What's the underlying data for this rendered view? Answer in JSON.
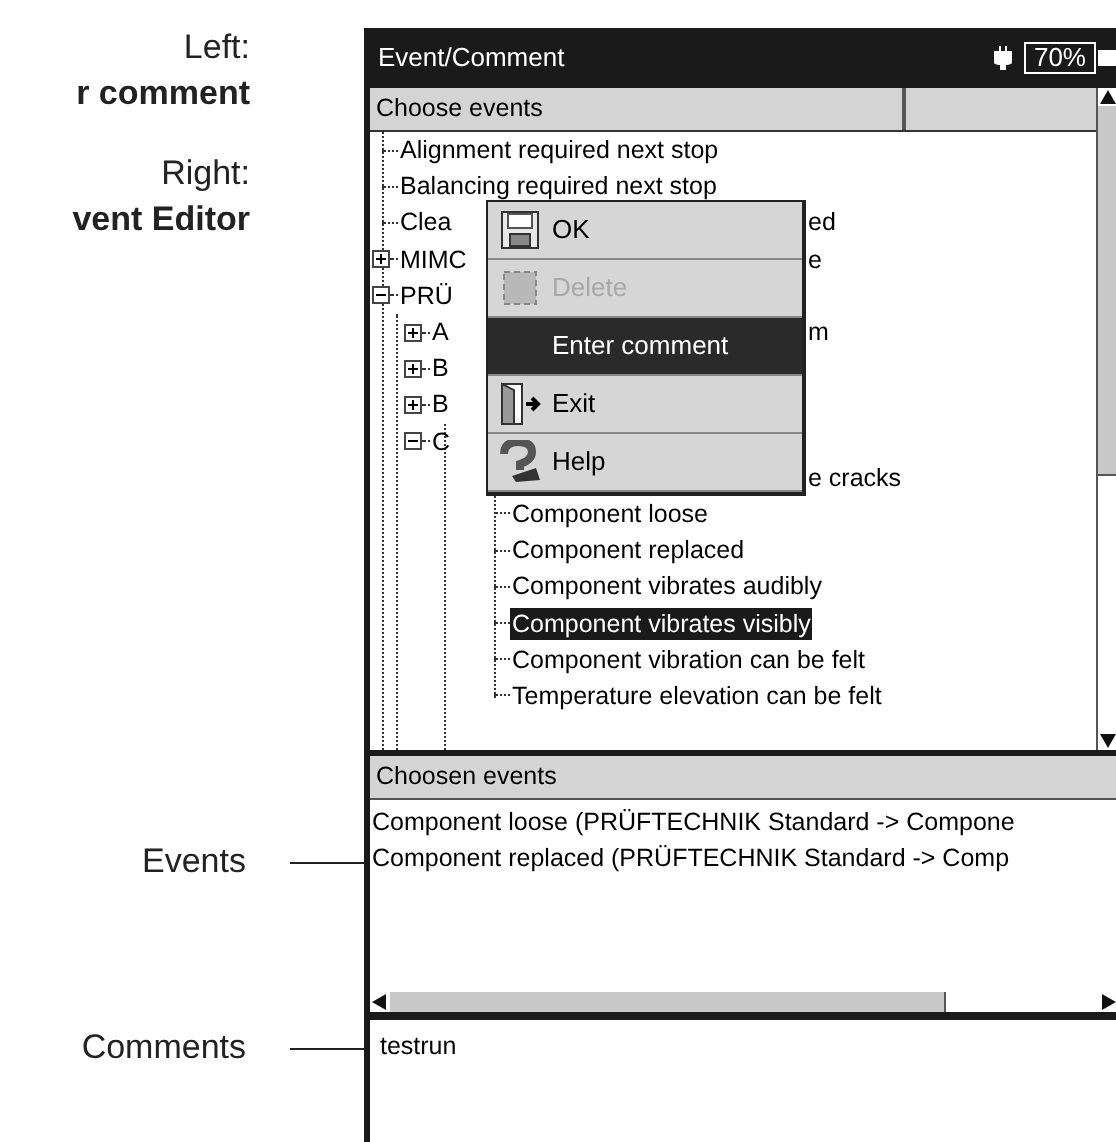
{
  "annotations": {
    "top": [
      {
        "text": "Left:",
        "bold": false
      },
      {
        "text": "r comment",
        "bold": true
      },
      {
        "text": "Right:",
        "bold": false
      },
      {
        "text": "vent Editor",
        "bold": true
      }
    ],
    "callouts": [
      "Events",
      "Comments"
    ]
  },
  "window": {
    "title": "Event/Comment",
    "battery": "70%"
  },
  "choose_events": {
    "header": "Choose events",
    "tree": [
      {
        "label": "Alignment required next stop",
        "selected": false
      },
      {
        "label": "Balancing required next stop",
        "selected": false
      },
      {
        "label": "Clea",
        "tail": "ed",
        "selected": false
      },
      {
        "label": "MIMC",
        "tail": "e",
        "expanded": false,
        "selected": false
      },
      {
        "label": "PRÜ",
        "expanded": true,
        "selected": false,
        "children": [
          {
            "label": "A",
            "tail": "m",
            "expanded": false,
            "selected": false
          },
          {
            "label": "B",
            "expanded": false,
            "selected": false
          },
          {
            "label": "B",
            "expanded": false,
            "selected": false
          },
          {
            "label": "C",
            "expanded": true,
            "selected": false,
            "children": [
              {
                "tail": "e cracks",
                "selected": false
              },
              {
                "label": "Component loose",
                "selected": false
              },
              {
                "label": "Component replaced",
                "selected": false
              },
              {
                "label": "Component vibrates audibly",
                "selected": false
              },
              {
                "label": "Component vibrates visibly",
                "selected": true
              },
              {
                "label": "Component vibration can be felt",
                "selected": false
              },
              {
                "label": "Temperature elevation can be felt",
                "selected": false
              }
            ]
          }
        ]
      }
    ]
  },
  "menu": [
    {
      "label": "OK",
      "disabled": false,
      "selected": false
    },
    {
      "label": "Delete",
      "disabled": true,
      "selected": false
    },
    {
      "label": "Enter comment",
      "disabled": false,
      "selected": true
    },
    {
      "label": "Exit",
      "disabled": false,
      "selected": false
    },
    {
      "label": "Help",
      "disabled": false,
      "selected": false
    }
  ],
  "chosen_events": {
    "header": "Choosen events",
    "items": [
      "Component loose (PRÜFTECHNIK Standard -> Compone",
      "Component replaced (PRÜFTECHNIK Standard -> Comp"
    ]
  },
  "comments": "testrun"
}
